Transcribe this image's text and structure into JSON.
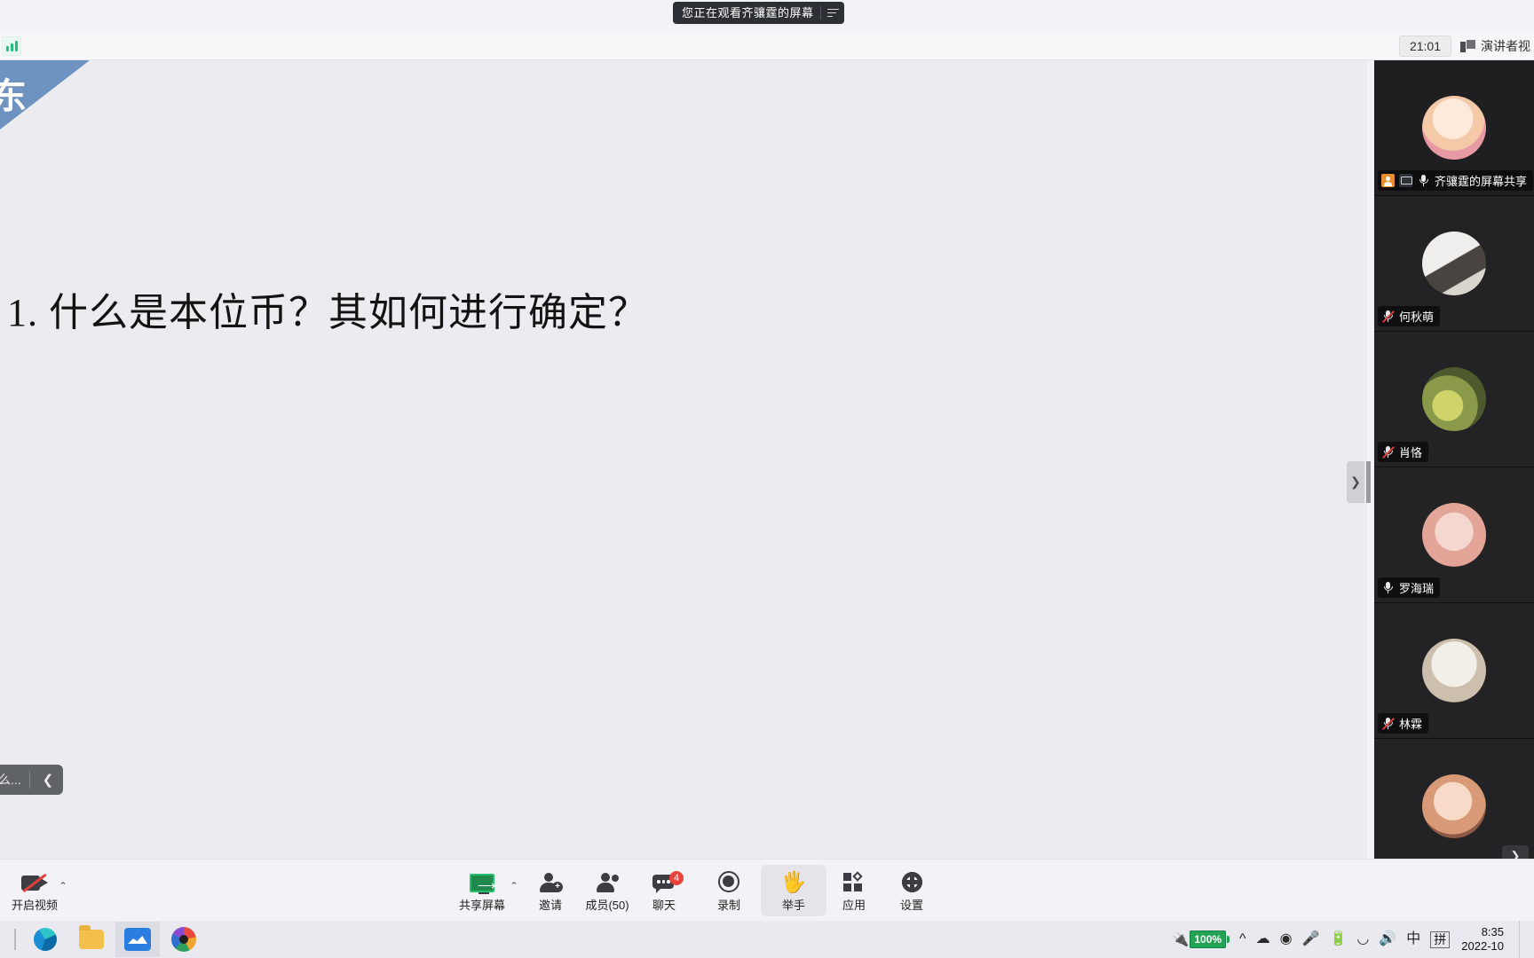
{
  "banner": {
    "text": "您正在观看齐骧霆的屏幕",
    "menu_icon": "hamburger-icon"
  },
  "top_bar": {
    "signal_icon": "signal-strength-icon",
    "clock": "21:01",
    "view_mode_label": "演讲者视",
    "view_mode_icon": "speaker-view-icon"
  },
  "share_view": {
    "slide": {
      "corner_text": "东",
      "title": "1. 什么是本位币？其如何进行确定？"
    },
    "annotation_pill": {
      "label": "原什么...",
      "collapse_icon": "chevron-left-icon"
    },
    "side_handle_icon": "chevron-right-icon"
  },
  "participants": [
    {
      "name": "齐骧霆的屏幕共享",
      "mic": "mic-on-icon",
      "muted": false,
      "label_pos": "bottom",
      "icons": [
        "person-icon",
        "screen-share-icon"
      ],
      "avatar": "av-a",
      "selected": true
    },
    {
      "name": "何秋萌",
      "mic": "mic-muted-icon",
      "muted": true,
      "label_pos": "bottom",
      "icons": [],
      "avatar": "av-b",
      "selected": false
    },
    {
      "name": "肖恪",
      "mic": "mic-muted-icon",
      "muted": true,
      "label_pos": "bottom",
      "icons": [],
      "avatar": "av-c",
      "selected": false
    },
    {
      "name": "罗海瑞",
      "mic": "mic-on-icon",
      "muted": false,
      "label_pos": "bottom",
      "icons": [],
      "avatar": "av-d",
      "selected": false
    },
    {
      "name": "林霖",
      "mic": "mic-muted-icon",
      "muted": true,
      "label_pos": "bottom",
      "icons": [],
      "avatar": "av-e",
      "selected": false
    },
    {
      "name": "",
      "mic": "",
      "muted": false,
      "label_pos": "bottom",
      "icons": [],
      "avatar": "av-f",
      "selected": false
    }
  ],
  "participants_scroll_icon": "chevron-down-icon",
  "controls": {
    "video": {
      "label": "开启视频",
      "icon": "camera-off-icon",
      "caret": "⌃"
    },
    "share": {
      "label": "共享屏幕",
      "icon": "screen-share-icon",
      "caret": "⌃"
    },
    "invite": {
      "label": "邀请",
      "icon": "invite-person-icon"
    },
    "members": {
      "label": "成员(50)",
      "icon": "members-icon"
    },
    "chat": {
      "label": "聊天",
      "icon": "chat-bubble-icon",
      "badge": "4"
    },
    "record": {
      "label": "录制",
      "icon": "record-circle-icon"
    },
    "raise_hand": {
      "label": "举手",
      "icon": "raise-hand-icon",
      "active": true
    },
    "apps": {
      "label": "应用",
      "icon": "apps-grid-icon"
    },
    "settings": {
      "label": "设置",
      "icon": "gear-icon"
    }
  },
  "taskbar": {
    "apps": [
      {
        "name": "edge",
        "icon": "edge-icon",
        "open": false
      },
      {
        "name": "file-explorer",
        "icon": "folder-icon",
        "open": false
      },
      {
        "name": "tencent-meeting",
        "icon": "meeting-icon",
        "open": true
      },
      {
        "name": "drawing-app",
        "icon": "palette-icon",
        "open": false
      }
    ],
    "tray": {
      "battery_pct": "100%",
      "plug_icon": "power-plug-icon",
      "overflow_icon": "chevron-up-icon",
      "cloud_icon": "cloud-icon",
      "camera_icon": "camera-privacy-icon",
      "mic_icon": "microphone-icon",
      "battery_icon": "battery-icon",
      "wifi_icon": "wifi-icon",
      "volume_icon": "speaker-icon",
      "ime_mode": "中",
      "ime_pinyin": "拼"
    },
    "clock_time": "8:35",
    "clock_date": "2022-10"
  }
}
